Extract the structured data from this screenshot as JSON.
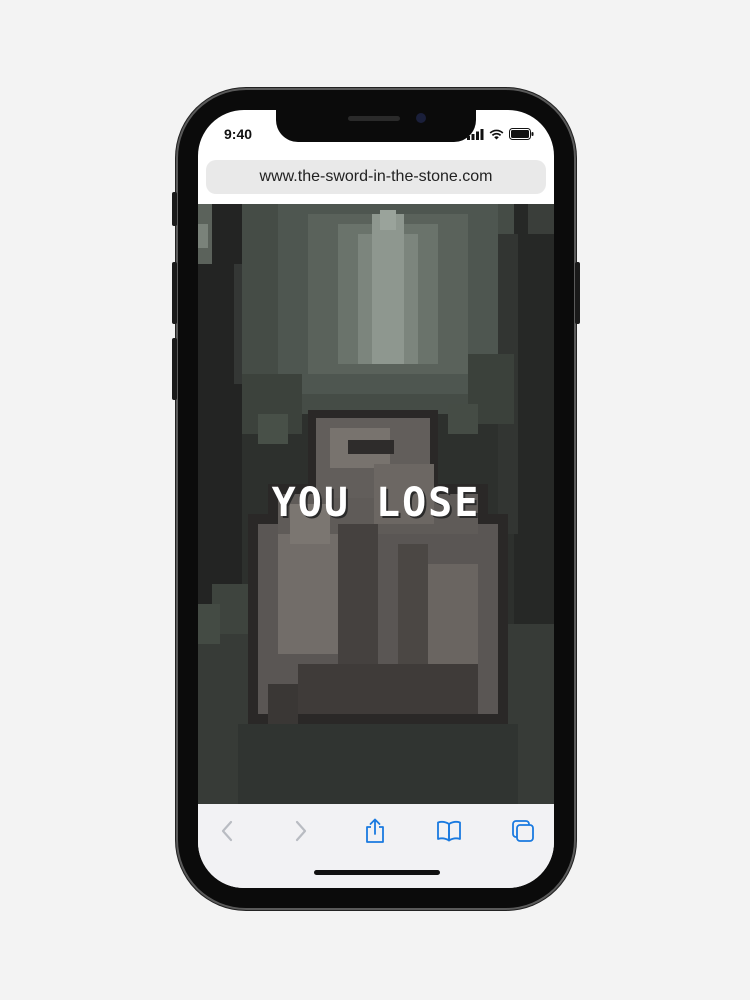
{
  "status_bar": {
    "time": "9:40"
  },
  "browser": {
    "url": "www.the-sword-in-the-stone.com"
  },
  "game": {
    "message": "YOU LOSE"
  },
  "toolbar": {
    "back_icon": "chevron-left-icon",
    "forward_icon": "chevron-right-icon",
    "share_icon": "share-icon",
    "bookmarks_icon": "book-icon",
    "tabs_icon": "tabs-icon"
  },
  "colors": {
    "accent": "#1a7ae0",
    "disabled": "#b9bcc2"
  }
}
